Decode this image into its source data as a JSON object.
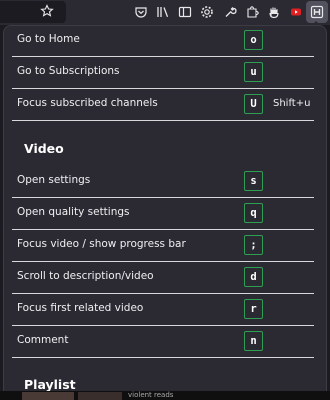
{
  "toolbar": {
    "icons": [
      "star-icon",
      "pocket-icon",
      "library-icon",
      "sidebar-icon",
      "settings-icon",
      "tools-icon",
      "extensions-icon",
      "hand-icon",
      "youtube-ext-icon",
      "keyboard-shortcuts-ext-icon"
    ]
  },
  "shortcuts": {
    "nav": [
      {
        "label": "Go to Home",
        "key": "o"
      },
      {
        "label": "Go to Subscriptions",
        "key": "u"
      },
      {
        "label": "Focus subscribed channels",
        "key": "U",
        "alt": "Shift+u"
      }
    ],
    "video_title": "Video",
    "video": [
      {
        "label": "Open settings",
        "key": "s"
      },
      {
        "label": "Open quality settings",
        "key": "q"
      },
      {
        "label": "Focus video / show progress bar",
        "key": ";"
      },
      {
        "label": "Scroll to description/video",
        "key": "d"
      },
      {
        "label": "Focus first related video",
        "key": "r"
      },
      {
        "label": "Comment",
        "key": "n"
      }
    ],
    "playlist_title": "Playlist"
  },
  "background_text": "violent reads",
  "colors": {
    "key_border": "#2e9e52",
    "panel_bg": "#2b2a33"
  }
}
